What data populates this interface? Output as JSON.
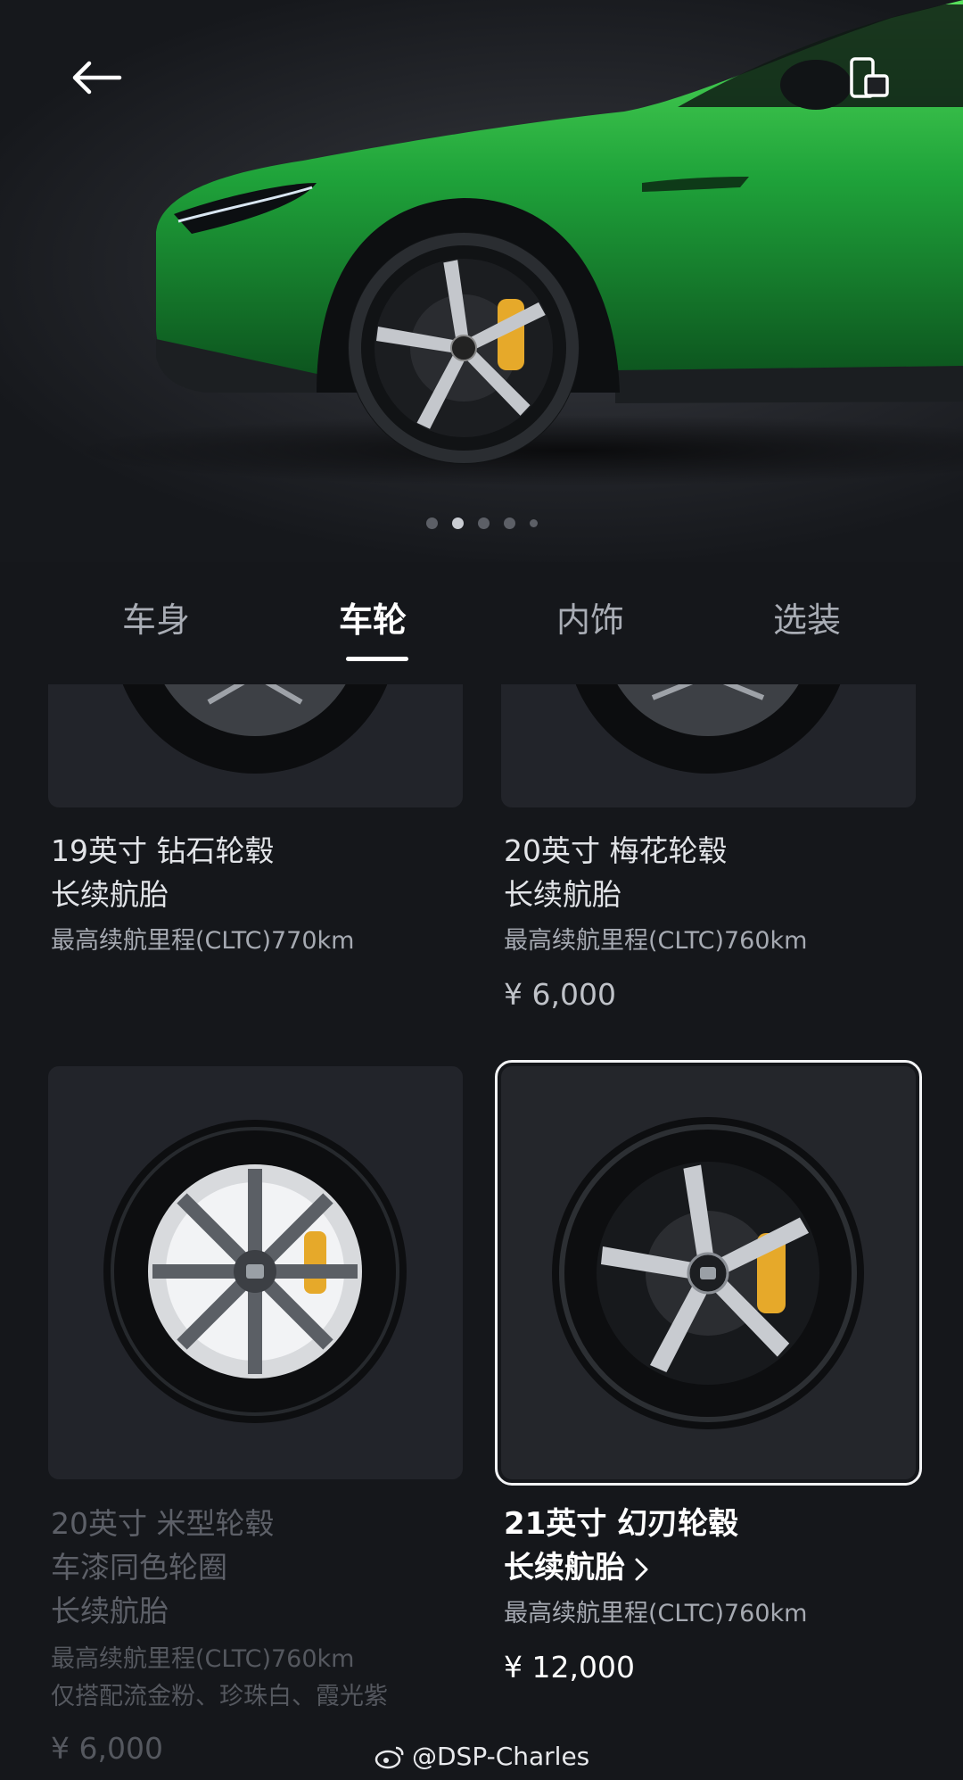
{
  "hero": {
    "image": "green-car-side-wheel-photo",
    "carousel": {
      "count": 5,
      "active": 1
    }
  },
  "icons": {
    "back": "arrow-left-icon",
    "device": "phone-device-icon"
  },
  "tabs": [
    {
      "label": "车身",
      "active": false
    },
    {
      "label": "车轮",
      "active": true
    },
    {
      "label": "内饰",
      "active": false
    },
    {
      "label": "选装",
      "active": false
    }
  ],
  "options": [
    {
      "title": "19英寸 钻石轮毂",
      "lines": [
        "长续航胎"
      ],
      "range": "最高续航里程(CLTC)770km",
      "price": ""
    },
    {
      "title": "20英寸 梅花轮毂",
      "lines": [
        "长续航胎"
      ],
      "range": "最高续航里程(CLTC)760km",
      "price": "¥ 6,000"
    },
    {
      "title": "20英寸 米型轮毂",
      "lines": [
        "车漆同色轮圈",
        "长续航胎"
      ],
      "range": "最高续航里程(CLTC)760km",
      "note": "仅搭配流金粉、珍珠白、霞光紫",
      "price": "¥ 6,000",
      "disabled": true
    },
    {
      "title": "21英寸 幻刃轮毂",
      "lines": [
        "长续航胎"
      ],
      "range": "最高续航里程(CLTC)760km",
      "price": "¥ 12,000",
      "selected": true
    }
  ],
  "watermark": "@DSP-Charles",
  "colors": {
    "car": "#1fa33a",
    "caliper": "#e6a92a",
    "background": "#15171b"
  }
}
